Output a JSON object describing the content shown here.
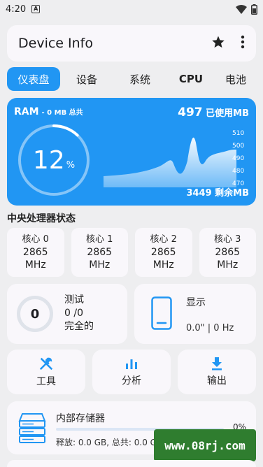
{
  "status_bar": {
    "time": "4:20",
    "badge": "A"
  },
  "app_bar": {
    "title": "Device Info",
    "star_icon": "star-icon",
    "more_icon": "more-vert-icon"
  },
  "tabs": [
    {
      "label": "仪表盘",
      "active": true
    },
    {
      "label": "设备"
    },
    {
      "label": "系统"
    },
    {
      "label": "CPU"
    },
    {
      "label": "电池"
    }
  ],
  "ram": {
    "label": "RAM",
    "total": "- 0 MB 总共",
    "used_value": "497",
    "used_suffix": "已使用MB",
    "free": "3449 剩余MB",
    "percent": "12",
    "percent_sign": "%",
    "usage_fraction": 0.12,
    "axis_ticks": [
      "510",
      "500",
      "490",
      "480",
      "470"
    ],
    "accent": "#2196f3"
  },
  "cpu": {
    "section_title": "中央处理器状态",
    "cores": [
      {
        "name": "核心 0",
        "freq": "2865",
        "unit": "MHz"
      },
      {
        "name": "核心 1",
        "freq": "2865",
        "unit": "MHz"
      },
      {
        "name": "核心 2",
        "freq": "2865",
        "unit": "MHz"
      },
      {
        "name": "核心 3",
        "freq": "2865",
        "unit": "MHz"
      }
    ]
  },
  "test": {
    "score": "0",
    "label": "测试",
    "ratio": "0 /0",
    "status": "完全的"
  },
  "display": {
    "label": "显示",
    "value": "0.0\" | 0 Hz"
  },
  "actions": [
    {
      "label": "工具",
      "icon": "tools-icon"
    },
    {
      "label": "分析",
      "icon": "bar-chart-icon"
    },
    {
      "label": "输出",
      "icon": "download-icon"
    }
  ],
  "storage": {
    "name": "内部存储器",
    "percent": "0%",
    "fraction": 0.0,
    "detail": "释放: 0.0 GB, 总共: 0.0 GB"
  },
  "watermark": "www.08rj.com"
}
